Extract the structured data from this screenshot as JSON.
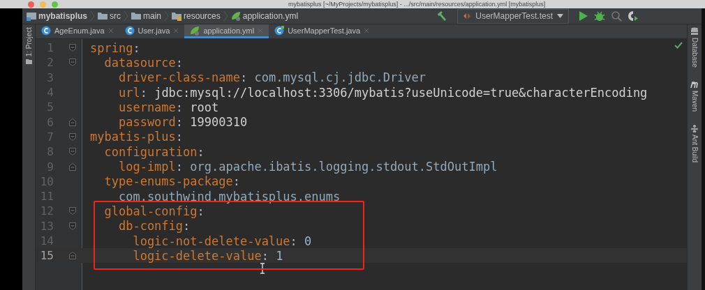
{
  "window": {
    "title": "mybatisplus [~/MyProjects/mybatisplus] - .../src/main/resources/application.yml [mybatisplus]"
  },
  "breadcrumbs": [
    {
      "label": "mybatisplus",
      "kind": "module"
    },
    {
      "label": "src",
      "kind": "folder"
    },
    {
      "label": "main",
      "kind": "folder"
    },
    {
      "label": "resources",
      "kind": "resources"
    },
    {
      "label": "application.yml",
      "kind": "yaml"
    }
  ],
  "run_configuration": {
    "label": "UserMapperTest.test"
  },
  "left_tool_windows": [
    {
      "label": "1: Project"
    }
  ],
  "tabs": [
    {
      "label": "AgeEnum.java",
      "kind": "class",
      "selected": false
    },
    {
      "label": "User.java",
      "kind": "class",
      "selected": false
    },
    {
      "label": "application.yml",
      "kind": "yaml",
      "selected": true
    },
    {
      "label": "UserMapperTest.java",
      "kind": "test",
      "selected": false
    }
  ],
  "editor": {
    "lines": [
      {
        "number": "1",
        "kind": "fold_start",
        "current": false,
        "highlighted": false,
        "segments": [
          {
            "text": "spring",
            "kind": "key"
          },
          {
            "text": ":",
            "kind": "punct"
          }
        ]
      },
      {
        "number": "2",
        "kind": "fold_start",
        "current": false,
        "highlighted": false,
        "segments": [
          {
            "text": "  datasource",
            "kind": "key"
          },
          {
            "text": ":",
            "kind": "punct"
          }
        ]
      },
      {
        "number": "3",
        "kind": "plain",
        "current": false,
        "highlighted": false,
        "segments": [
          {
            "text": "    driver-class-name",
            "kind": "key"
          },
          {
            "text": ": ",
            "kind": "punct"
          },
          {
            "text": "com.mysql.cj.jdbc.Driver",
            "kind": "value"
          }
        ]
      },
      {
        "number": "4",
        "kind": "plain",
        "current": false,
        "highlighted": false,
        "segments": [
          {
            "text": "    url",
            "kind": "key"
          },
          {
            "text": ": ",
            "kind": "punct"
          },
          {
            "text": "jdbc:mysql://localhost:3306/mybatis?useUnicode=true&characterEncoding",
            "kind": "plain"
          }
        ]
      },
      {
        "number": "5",
        "kind": "plain",
        "current": false,
        "highlighted": false,
        "segments": [
          {
            "text": "    username",
            "kind": "key"
          },
          {
            "text": ": ",
            "kind": "punct"
          },
          {
            "text": "root",
            "kind": "plain"
          }
        ]
      },
      {
        "number": "6",
        "kind": "fold_end",
        "current": false,
        "highlighted": false,
        "segments": [
          {
            "text": "    password",
            "kind": "key"
          },
          {
            "text": ": ",
            "kind": "punct"
          },
          {
            "text": "19900310",
            "kind": "plain"
          }
        ]
      },
      {
        "number": "7",
        "kind": "fold_start",
        "current": false,
        "highlighted": false,
        "segments": [
          {
            "text": "mybatis-plus",
            "kind": "key"
          },
          {
            "text": ":",
            "kind": "punct"
          }
        ]
      },
      {
        "number": "8",
        "kind": "fold_start",
        "current": false,
        "highlighted": false,
        "segments": [
          {
            "text": "  configuration",
            "kind": "key"
          },
          {
            "text": ":",
            "kind": "punct"
          }
        ]
      },
      {
        "number": "9",
        "kind": "fold_end",
        "current": false,
        "highlighted": false,
        "segments": [
          {
            "text": "    log-impl",
            "kind": "key"
          },
          {
            "text": ": ",
            "kind": "punct"
          },
          {
            "text": "org.apache.ibatis.logging.stdout.StdOutImpl",
            "kind": "value"
          }
        ]
      },
      {
        "number": "10",
        "kind": "plain",
        "current": false,
        "highlighted": false,
        "segments": [
          {
            "text": "  type-enums-package",
            "kind": "key"
          },
          {
            "text": ":",
            "kind": "punct"
          }
        ]
      },
      {
        "number": "11",
        "kind": "plain",
        "current": false,
        "highlighted": false,
        "segments": [
          {
            "text": "    com.southwind.mybatisplus.enums",
            "kind": "value"
          }
        ]
      },
      {
        "number": "12",
        "kind": "fold_start",
        "current": false,
        "highlighted": true,
        "segments": [
          {
            "text": "  global-config",
            "kind": "key"
          },
          {
            "text": ":",
            "kind": "punct"
          }
        ]
      },
      {
        "number": "13",
        "kind": "fold_start",
        "current": false,
        "highlighted": true,
        "segments": [
          {
            "text": "    db-config",
            "kind": "key"
          },
          {
            "text": ":",
            "kind": "punct"
          }
        ]
      },
      {
        "number": "14",
        "kind": "plain",
        "current": false,
        "highlighted": true,
        "segments": [
          {
            "text": "      logic-not-delete-value",
            "kind": "key"
          },
          {
            "text": ": ",
            "kind": "punct"
          },
          {
            "text": "0",
            "kind": "number"
          }
        ]
      },
      {
        "number": "15",
        "kind": "fold_end",
        "current": true,
        "highlighted": true,
        "segments": [
          {
            "text": "      logic-delete-value",
            "kind": "key"
          },
          {
            "text": ": ",
            "kind": "punct"
          },
          {
            "text": "1",
            "kind": "number"
          }
        ]
      }
    ]
  },
  "right_tool_windows": [
    {
      "label": "Database",
      "kind": "database"
    },
    {
      "label": "Maven",
      "kind": "maven"
    },
    {
      "label": "Ant Build",
      "kind": "ant"
    }
  ]
}
